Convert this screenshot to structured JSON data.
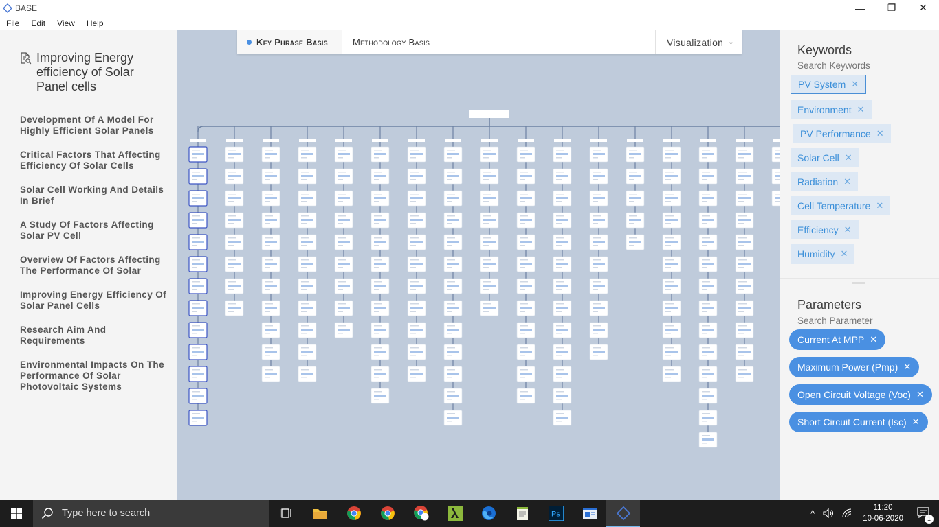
{
  "window": {
    "title": "BASE",
    "minimize": "—",
    "maximize": "❐",
    "close": "✕"
  },
  "menu": [
    "File",
    "Edit",
    "View",
    "Help"
  ],
  "document": {
    "title": "Improving Energy efficiency of Solar Panel cells",
    "sections": [
      "Development Of A Model For Highly Efficient Solar Panels",
      "Critical Factors That Affecting Efficiency Of Solar Cells",
      "Solar Cell Working And Details In Brief",
      "A Study Of Factors Affecting Solar PV Cell",
      "Overview Of Factors Affecting The Performance Of Solar",
      "Improving Energy Efficiency Of Solar Panel Cells",
      "Research Aim And Requirements",
      "Environmental Impacts On The Performance Of Solar Photovoltaic Systems"
    ]
  },
  "tabs": {
    "key_phrase": "Key Phrase Basis",
    "methodology": "Methodology Basis",
    "visualization": "Visualization",
    "visualization_chevron": "⌄"
  },
  "tree": {
    "column_node_counts": [
      13,
      8,
      11,
      11,
      9,
      12,
      11,
      13,
      8,
      12,
      13,
      10,
      5,
      11,
      14,
      11,
      3
    ],
    "selected_column": 0,
    "colors": {
      "line": "#6d82a3",
      "node_fill": "#ffffff",
      "node_bar": "#a9c4ea",
      "selected_border": "#3d56c4"
    }
  },
  "keywords": {
    "title": "Keywords",
    "search_placeholder": "Search Keywords",
    "items": [
      "PV System",
      "Environment",
      "PV Performance",
      "Solar Cell",
      "Radiation",
      "Cell Temperature",
      "Efficiency",
      "Humidity"
    ],
    "remove_glyph": "✕"
  },
  "parameters": {
    "title": "Parameters",
    "search_placeholder": "Search Parameter",
    "items": [
      "Current At MPP",
      "Maximum Power (Pmp)",
      "Open Circuit Voltage (Voc)",
      "Short Circuit Current (Isc)"
    ],
    "remove_glyph": "✕"
  },
  "taskbar": {
    "search_placeholder": "Type here to search",
    "apps": [
      "task-view",
      "file-explorer",
      "chrome-1",
      "chrome-2",
      "chrome-3",
      "lambda-app",
      "firefox",
      "notepad-app",
      "photoshop",
      "terminal-app",
      "base-app"
    ],
    "time": "11:20",
    "date": "10-06-2020",
    "notification_count": "1"
  },
  "colors": {
    "accent": "#4a90e2",
    "canvas_bg": "#bfcbdb",
    "chip_bg": "#dde8f4",
    "chip_text": "#3b8fd9"
  }
}
